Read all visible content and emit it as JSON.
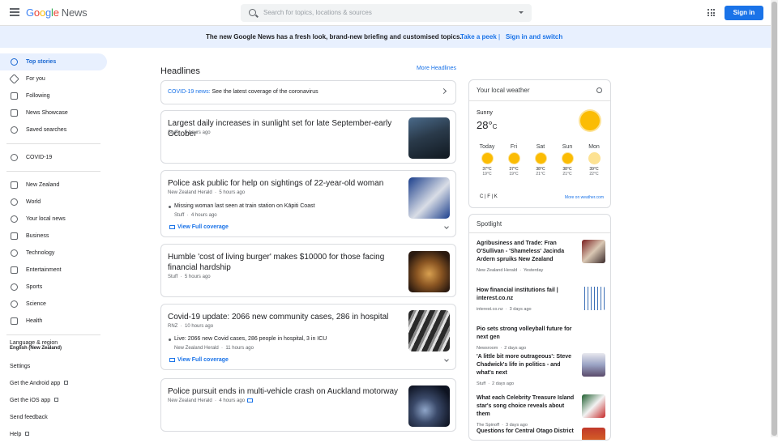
{
  "header": {
    "logo_google": [
      "G",
      "o",
      "o",
      "g",
      "l",
      "e"
    ],
    "logo_news": "News",
    "search_placeholder": "Search for topics, locations & sources",
    "signin_label": "Sign in"
  },
  "banner": {
    "text": "The new Google News has a fresh look, brand-new briefing and customised topics.",
    "peek": "Take a peek",
    "separator": "|",
    "switch": "Sign in and switch"
  },
  "sidebar": {
    "items": [
      {
        "label": "Top stories",
        "icon": "globe-icon"
      },
      {
        "label": "For you",
        "icon": "diamond-icon"
      },
      {
        "label": "Following",
        "icon": "star-icon"
      },
      {
        "label": "News Showcase",
        "icon": "showcase-icon"
      },
      {
        "label": "Saved searches",
        "icon": "search-icon"
      }
    ],
    "covid": {
      "label": "COVID-19",
      "icon": "shield-icon"
    },
    "sections": [
      {
        "label": "New Zealand",
        "icon": "flag-icon"
      },
      {
        "label": "World",
        "icon": "world-icon"
      },
      {
        "label": "Your local news",
        "icon": "location-icon"
      },
      {
        "label": "Business",
        "icon": "business-icon"
      },
      {
        "label": "Technology",
        "icon": "technology-icon"
      },
      {
        "label": "Entertainment",
        "icon": "entertainment-icon"
      },
      {
        "label": "Sports",
        "icon": "bike-icon"
      },
      {
        "label": "Science",
        "icon": "science-icon"
      },
      {
        "label": "Health",
        "icon": "health-icon"
      }
    ],
    "language_label": "Language & region",
    "language_value": "English (New Zealand)",
    "settings": "Settings",
    "android": "Get the Android app",
    "ios": "Get the iOS app",
    "feedback": "Send feedback",
    "help": "Help"
  },
  "headlines": {
    "title": "Headlines",
    "more": "More Headlines",
    "covid_prefix": "COVID-19 news:",
    "covid_text": "See the latest coverage of the coronavirus",
    "stories": [
      {
        "title": "Largest daily increases in sunlight set for late September-early October",
        "source": "Stuff",
        "time": "5 hours ago"
      },
      {
        "title": "Police ask public for help on sightings of 22-year-old woman",
        "source": "New Zealand Herald",
        "time": "5 hours ago",
        "sub_title": "Missing woman last seen at train station on Kāpiti Coast",
        "sub_source": "Stuff",
        "sub_time": "4 hours ago"
      },
      {
        "title": "Humble 'cost of living burger' makes $10000 for those facing financial hardship",
        "source": "Stuff",
        "time": "5 hours ago"
      },
      {
        "title": "Covid-19 update: 2066 new community cases, 286 in hospital",
        "source": "RNZ",
        "time": "10 hours ago",
        "sub_title": "Live: 2066 new Covid cases, 286 people in hospital, 3 in ICU",
        "sub_source": "New Zealand Herald",
        "sub_time": "11 hours ago"
      },
      {
        "title": "Police pursuit ends in multi-vehicle crash on Auckland motorway",
        "source": "New Zealand Herald",
        "time": "4 hours ago"
      }
    ],
    "full_coverage": "View Full coverage",
    "dot": "·"
  },
  "weather": {
    "title": "Your local weather",
    "condition": "Sunny",
    "temp": "28°",
    "unit": "C",
    "days": [
      {
        "day": "Today",
        "hi": "37°C",
        "lo": "19°C"
      },
      {
        "day": "Fri",
        "hi": "37°C",
        "lo": "19°C"
      },
      {
        "day": "Sat",
        "hi": "38°C",
        "lo": "21°C"
      },
      {
        "day": "Sun",
        "hi": "38°C",
        "lo": "21°C"
      },
      {
        "day": "Mon",
        "hi": "39°C",
        "lo": "22°C"
      }
    ],
    "units": "C  |  F  |  K",
    "link": "More on weather.com"
  },
  "spotlight": {
    "title": "Spotlight",
    "items": [
      {
        "title": "Agribusiness and Trade: Fran O'Sullivan - 'Shameless' Jacinda Ardern spruiks New Zealand",
        "source": "New Zealand Herald",
        "time": "Yesterday"
      },
      {
        "title": "How financial institutions fail | interest.co.nz",
        "source": "interest.co.nz",
        "time": "3 days ago"
      },
      {
        "title": "Pio sets strong volleyball future for next gen",
        "source": "Newsroom",
        "time": "2 days ago"
      },
      {
        "title": "'A little bit more outrageous': Steve Chadwick's life in politics - and what's next",
        "source": "Stuff",
        "time": "2 days ago"
      },
      {
        "title": "What each Celebrity Treasure Island star's song choice reveals about them",
        "source": "The Spinoff",
        "time": "3 days ago"
      },
      {
        "title": "Questions for Central Otago District",
        "source": "",
        "time": ""
      }
    ]
  }
}
